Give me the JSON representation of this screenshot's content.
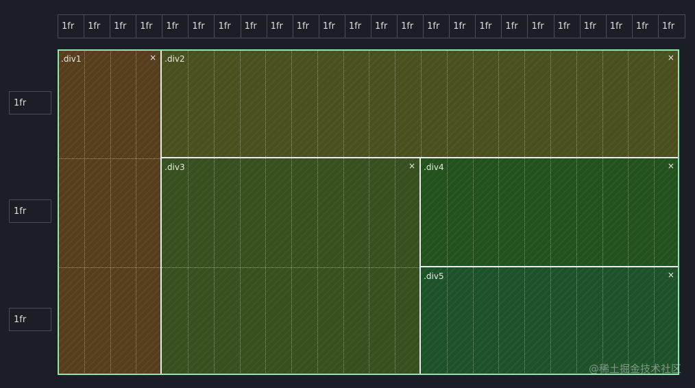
{
  "columns": [
    "1fr",
    "1fr",
    "1fr",
    "1fr",
    "1fr",
    "1fr",
    "1fr",
    "1fr",
    "1fr",
    "1fr",
    "1fr",
    "1fr",
    "1fr",
    "1fr",
    "1fr",
    "1fr",
    "1fr",
    "1fr",
    "1fr",
    "1fr",
    "1fr",
    "1fr",
    "1fr",
    "1fr"
  ],
  "rows": [
    "1fr",
    "1fr",
    "1fr"
  ],
  "areas": [
    {
      "label": ".div1",
      "close": "×",
      "col_start": 1,
      "col_end": 5,
      "row_start": 1,
      "row_end": 4,
      "color": "#563e1d"
    },
    {
      "label": ".div2",
      "close": "×",
      "col_start": 5,
      "col_end": 25,
      "row_start": 1,
      "row_end": 2,
      "color": "#4b4f1e"
    },
    {
      "label": ".div3",
      "close": "×",
      "col_start": 5,
      "col_end": 15,
      "row_start": 2,
      "row_end": 4,
      "color": "#384f1f"
    },
    {
      "label": ".div4",
      "close": "×",
      "col_start": 15,
      "col_end": 25,
      "row_start": 2,
      "row_end": 3,
      "color": "#22511d"
    },
    {
      "label": ".div5",
      "close": "×",
      "col_start": 15,
      "col_end": 25,
      "row_start": 3,
      "row_end": 4,
      "color": "#1d5228"
    }
  ],
  "colors": {
    "background": "#1c1e26",
    "outline": "#8ee6b4"
  },
  "watermark": "@稀土掘金技术社区"
}
